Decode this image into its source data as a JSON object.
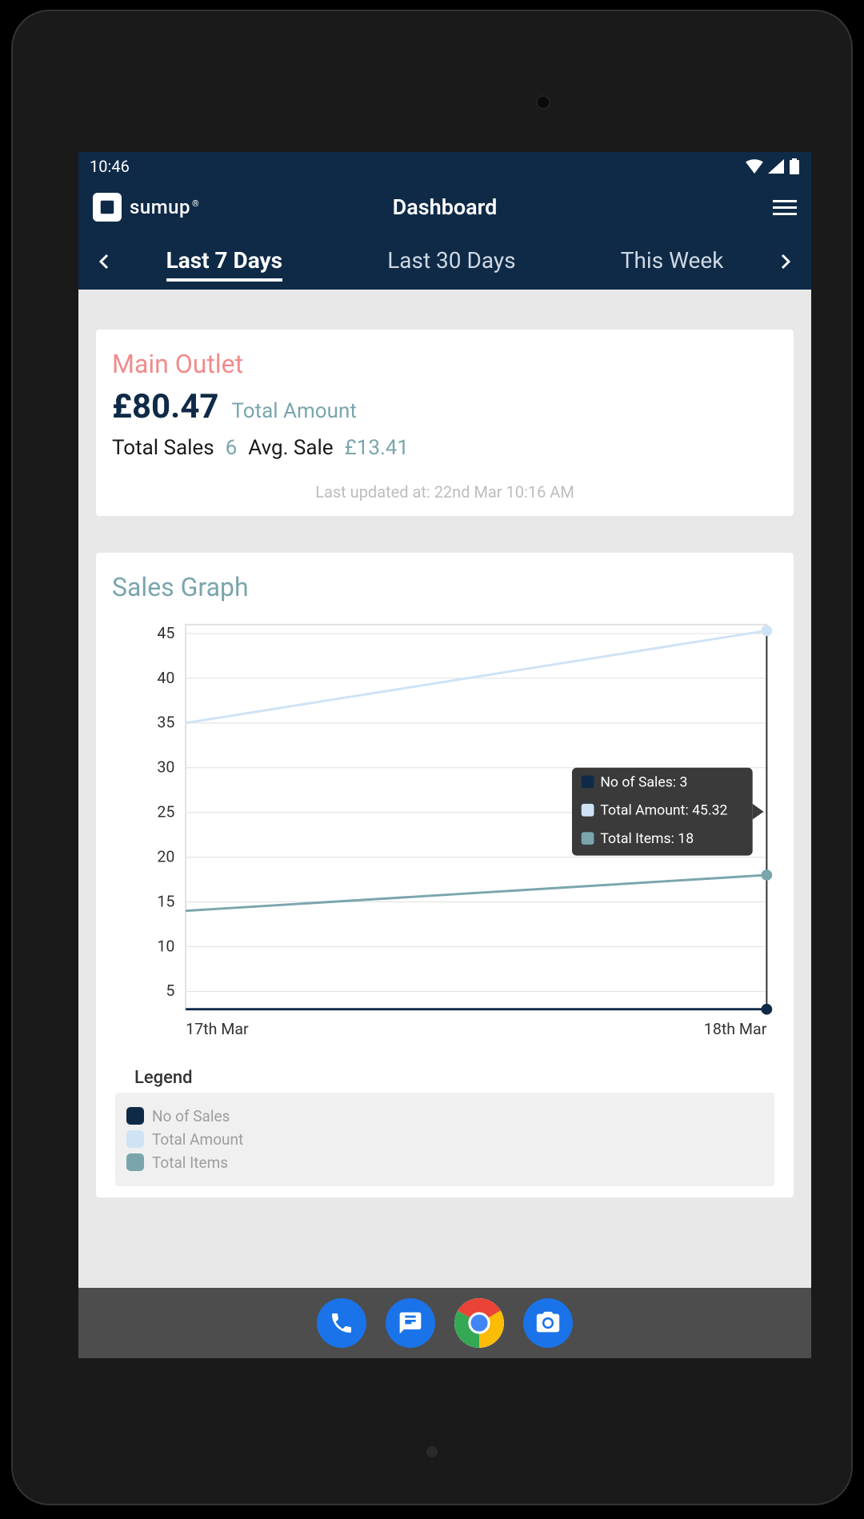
{
  "status": {
    "time": "10:46"
  },
  "appbar": {
    "brand": "sumup",
    "title": "Dashboard"
  },
  "tabs": {
    "items": [
      {
        "label": "Last 7 Days",
        "active": true
      },
      {
        "label": "Last 30 Days",
        "active": false
      },
      {
        "label": "This Week",
        "active": false
      }
    ]
  },
  "summary": {
    "outlet": "Main Outlet",
    "total_amount": "£80.47",
    "total_amount_label": "Total Amount",
    "total_sales_label": "Total Sales",
    "total_sales": "6",
    "avg_sale_label": "Avg. Sale",
    "avg_sale": "£13.41",
    "updated": "Last updated at: 22nd Mar 10:16 AM"
  },
  "chart_title": "Sales Graph",
  "chart_data": {
    "type": "line",
    "x": [
      "17th Mar",
      "18th Mar"
    ],
    "y_ticks": [
      5,
      10,
      15,
      20,
      25,
      30,
      35,
      40,
      45
    ],
    "ylim": [
      3,
      46
    ],
    "series": [
      {
        "name": "No of Sales",
        "color": "#0e2a47",
        "values": [
          3,
          3
        ]
      },
      {
        "name": "Total Amount",
        "color": "#cfe3f5",
        "values": [
          35,
          45.32
        ]
      },
      {
        "name": "Total Items",
        "color": "#7aa5ad",
        "values": [
          14,
          18
        ]
      }
    ],
    "tooltip": {
      "at_index": 1,
      "rows": [
        {
          "label": "No of Sales: 3",
          "color": "#0e2a47"
        },
        {
          "label": "Total Amount: 45.32",
          "color": "#cfe3f5"
        },
        {
          "label": "Total Items: 18",
          "color": "#7aa5ad"
        }
      ]
    }
  },
  "legend": {
    "title": "Legend",
    "items": [
      {
        "label": "No of Sales",
        "color": "#0e2a47"
      },
      {
        "label": "Total Amount",
        "color": "#cfe3f5"
      },
      {
        "label": "Total Items",
        "color": "#7aa5ad"
      }
    ]
  },
  "colors": {
    "primary": "#0e2a47",
    "teal": "#7aa5ad",
    "salmon": "#f08c8c"
  }
}
